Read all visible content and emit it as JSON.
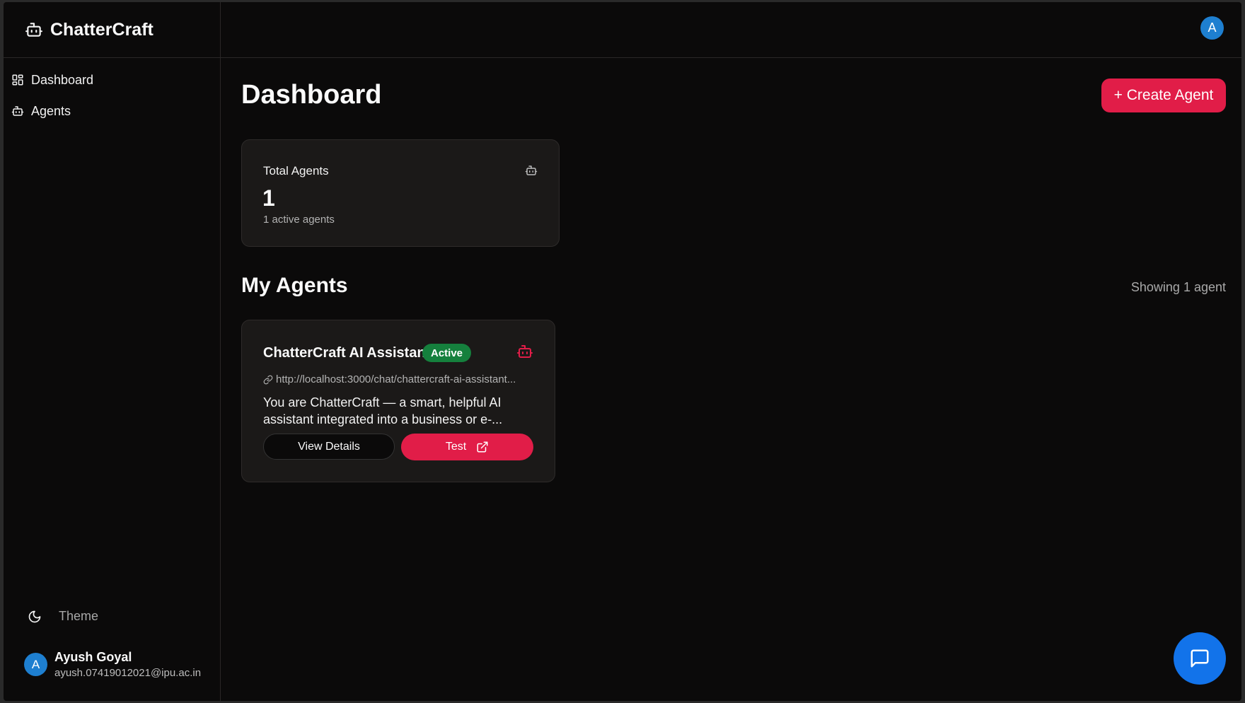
{
  "app": {
    "name": "ChatterCraft"
  },
  "sidebar": {
    "items": [
      {
        "label": "Dashboard",
        "icon": "layout-grid-icon"
      },
      {
        "label": "Agents",
        "icon": "bot-icon"
      }
    ],
    "theme_label": "Theme",
    "user": {
      "initial": "A",
      "name": "Ayush Goyal",
      "email": "ayush.07419012021@ipu.ac.in"
    }
  },
  "header": {
    "avatar_initial": "A"
  },
  "main": {
    "title": "Dashboard",
    "create_button": "+ Create Agent",
    "stats": {
      "total_label": "Total Agents",
      "total_value": "1",
      "total_sub": "1 active agents"
    },
    "agents_section": {
      "title": "My Agents",
      "showing": "Showing 1 agent",
      "agents": [
        {
          "name": "ChatterCraft AI Assistant",
          "status": "Active",
          "url": "http://localhost:3000/chat/chattercraft-ai-assistant...",
          "description": "You are ChatterCraft — a smart, helpful AI assistant integrated into a business or e-...",
          "details_label": "View Details",
          "test_label": "Test"
        }
      ]
    }
  },
  "colors": {
    "accent": "#e11d48",
    "status_active": "#15803d",
    "avatar": "#1e7fd0",
    "chat_fab": "#1273ea",
    "background": "#0b0a0a",
    "card": "#1b1918"
  }
}
